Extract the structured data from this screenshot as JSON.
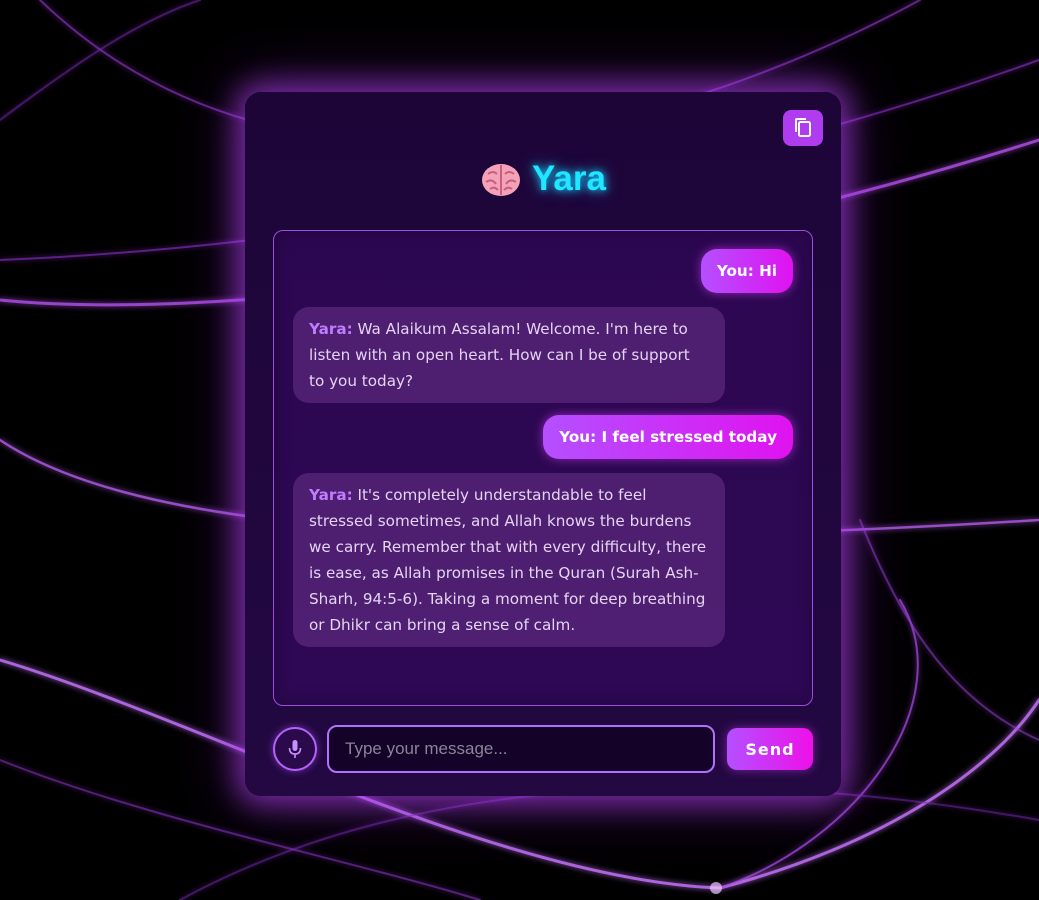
{
  "app": {
    "title": "Yara",
    "title_icon": "brain-icon",
    "accent_color": "#1ee7ff",
    "primary_color": "#b450ff",
    "secondary_color": "#e012f0"
  },
  "toolbar": {
    "copy_icon": "copy-icon"
  },
  "messages": [
    {
      "role": "user",
      "sender": "You:",
      "text": "Hi"
    },
    {
      "role": "bot",
      "sender": "Yara:",
      "text": "Wa Alaikum Assalam! Welcome. I'm here to listen with an open heart. How can I be of support to you today?"
    },
    {
      "role": "user",
      "sender": "You:",
      "text": "I feel stressed today"
    },
    {
      "role": "bot",
      "sender": "Yara:",
      "text": "It's completely understandable to feel stressed sometimes, and Allah knows the burdens we carry. Remember that with every difficulty, there is ease, as Allah promises in the Quran (Surah Ash-Sharh, 94:5-6). Taking a moment for deep breathing or Dhikr can bring a sense of calm."
    }
  ],
  "composer": {
    "mic_icon": "microphone-icon",
    "placeholder": "Type your message...",
    "value": "",
    "send_label": "Send"
  }
}
